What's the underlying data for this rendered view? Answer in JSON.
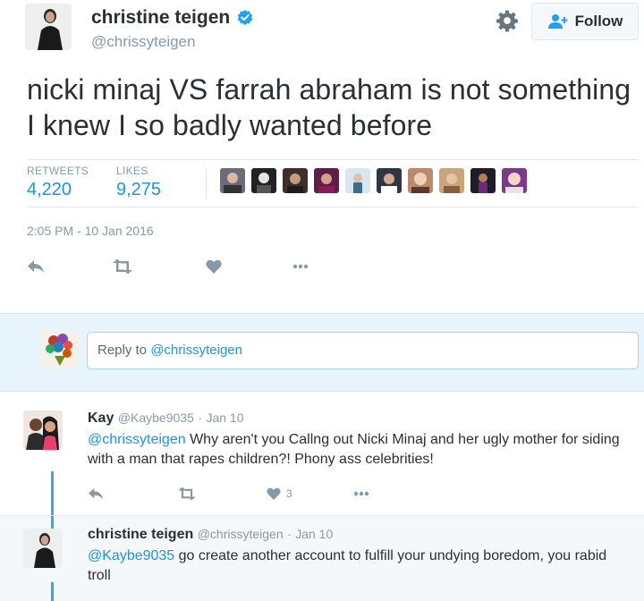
{
  "tweet": {
    "display_name": "christine teigen",
    "handle": "@chrissyteigen",
    "follow_label": "Follow",
    "text": "nicki minaj VS farrah abraham is not something I knew I so badly wanted before",
    "retweets_label": "RETWEETS",
    "retweets_count": "4,220",
    "likes_label": "LIKES",
    "likes_count": "9,275",
    "timestamp": "2:05 PM - 10 Jan 2016",
    "liker_faces": 10
  },
  "reply_box": {
    "prefix": "Reply to ",
    "mention": "@chrissyteigen"
  },
  "replies": [
    {
      "name": "Kay",
      "handle": "@Kaybe9035",
      "date": "Jan 10",
      "mention": "@chrissyteigen",
      "text": " Why aren't you Callng out Nicki Minaj and her ugly mother for siding with a man that rapes children?! Phony ass celebrities!",
      "like_count": "3"
    },
    {
      "name": "christine teigen",
      "handle": "@chrissyteigen",
      "date": "Jan 10",
      "mention": "@Kaybe9035",
      "text": " go create another account to fulfill your undying boredom, you rabid troll"
    }
  ],
  "colors": {
    "link_blue": "#1b95e0",
    "muted_gray": "#8899a6",
    "reply_bg": "#e8f4fb",
    "text": "#292f33"
  },
  "icons": [
    "verified-icon",
    "gear-icon",
    "follow-person-icon",
    "reply-icon",
    "retweet-icon",
    "heart-icon",
    "more-icon"
  ]
}
